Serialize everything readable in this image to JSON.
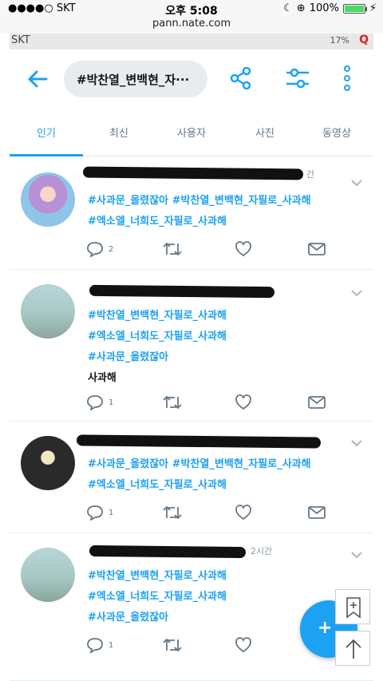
{
  "ios_status": {
    "carrier": "●●●●○ SKT",
    "time": "오후 5:08",
    "battery": "100%"
  },
  "url": "pann.nate.com",
  "android_status": {
    "left": "SKT",
    "right": "17%"
  },
  "search": {
    "query": "#박찬열_변백현_자···"
  },
  "tabs": [
    "인기",
    "최신",
    "사용자",
    "사진",
    "동영상"
  ],
  "active_tab": "인기",
  "tweets": [
    {
      "meta": "간",
      "lines": [
        [
          {
            "text": "#사과문_올렸잖아",
            "tag": true
          },
          {
            "text": "  ",
            "tag": false
          },
          {
            "text": "#박찬열_변백현_자필로_사과해",
            "tag": true
          }
        ],
        [
          {
            "text": "#엑소엘_너희도_자필로_사과해",
            "tag": true
          }
        ]
      ],
      "reply_count": "2"
    },
    {
      "meta": "",
      "lines": [
        [
          {
            "text": "#박찬열_변백현_자필로_사과해",
            "tag": true
          }
        ],
        [
          {
            "text": "#엑소엘_너희도_자필로_사과해",
            "tag": true
          }
        ],
        [
          {
            "text": "#사과문_올렸잖아",
            "tag": true
          }
        ],
        [
          {
            "text": "사과해",
            "tag": false
          }
        ]
      ],
      "reply_count": "1"
    },
    {
      "meta": "",
      "lines": [
        [
          {
            "text": "#사과문_올렸잖아",
            "tag": true
          },
          {
            "text": "  ",
            "tag": false
          },
          {
            "text": "#박찬열_변백현_자필로_사과해",
            "tag": true
          }
        ],
        [
          {
            "text": "#엑소엘_너희도_자필로_사과해",
            "tag": true
          }
        ]
      ],
      "reply_count": "1"
    },
    {
      "meta": "2시간",
      "lines": [
        [
          {
            "text": "#박찬열_변백현_자필로_사과해",
            "tag": true
          }
        ],
        [
          {
            "text": "#엑소엘_너희도_자필로_사과해",
            "tag": true
          }
        ],
        [
          {
            "text": "#사과문_올렸잖아",
            "tag": true
          }
        ]
      ],
      "reply_count": "1"
    }
  ],
  "colors": {
    "accent": "#1da1f2",
    "text": "#14171a",
    "muted": "#657786"
  }
}
